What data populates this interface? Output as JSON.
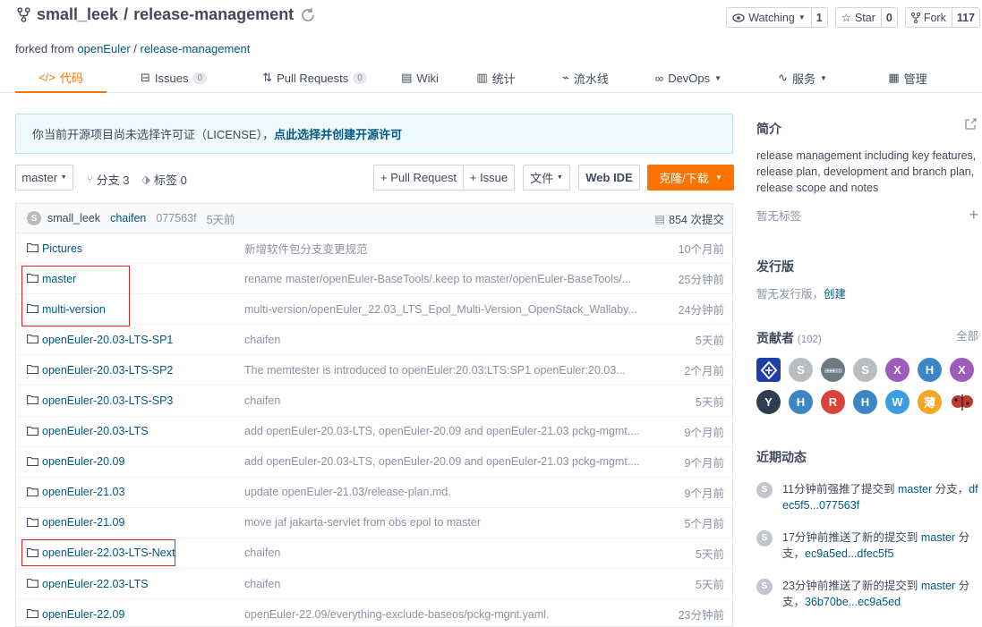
{
  "repo": {
    "owner": "small_leek",
    "sep": "/",
    "name": "release-management",
    "forked_prefix": "forked from",
    "forked_owner": "openEuler",
    "forked_repo": "release-management"
  },
  "actions": {
    "watch_label": "Watching",
    "watch_count": "1",
    "star_label": "Star",
    "star_count": "0",
    "fork_label": "Fork",
    "fork_count": "117"
  },
  "tabs": [
    {
      "label": "代码",
      "active": true
    },
    {
      "label": "Issues",
      "badge": "0"
    },
    {
      "label": "Pull Requests",
      "badge": "0"
    },
    {
      "label": "Wiki"
    },
    {
      "label": "统计"
    },
    {
      "label": "流水线"
    },
    {
      "label": "DevOps"
    },
    {
      "label": "服务"
    },
    {
      "label": "管理"
    }
  ],
  "notice": {
    "text": "你当前开源项目尚未选择许可证（LICENSE），",
    "link": "点此选择并创建开源许可"
  },
  "toolbar": {
    "branch": "master",
    "branches": "分支 3",
    "tags": "标签 0",
    "pull_request": "+ Pull Request",
    "issue": "+ Issue",
    "file": "文件",
    "web_ide": "Web IDE",
    "clone": "克隆/下载"
  },
  "commit": {
    "avatar": "S",
    "author": "small_leek",
    "committer": "chaifen",
    "sha": "077563f",
    "time": "5天前",
    "count": "854 次提交"
  },
  "files": [
    {
      "name": "Pictures",
      "msg": "新增软件包分支变更规范",
      "time": "10个月前"
    },
    {
      "name": "master",
      "msg": "rename master/openEuler-BaseTools/.keep to master/openEuler-BaseTools/...",
      "time": "25分钟前"
    },
    {
      "name": "multi-version",
      "msg": "multi-version/openEuler_22.03_LTS_Epol_Multi-Version_OpenStack_Wallaby...",
      "time": "24分钟前"
    },
    {
      "name": "openEuler-20.03-LTS-SP1",
      "msg": "chaifen",
      "time": "5天前"
    },
    {
      "name": "openEuler-20.03-LTS-SP2",
      "msg": "The memtester is introduced to openEuler:20.03:LTS:SP1 openEuler:20.03...",
      "time": "2个月前"
    },
    {
      "name": "openEuler-20.03-LTS-SP3",
      "msg": "chaifen",
      "time": "5天前"
    },
    {
      "name": "openEuler-20.03-LTS",
      "msg": "add openEuler-20.03-LTS, openEuler-20.09 and openEuler-21.03 pckg-mgmt....",
      "time": "9个月前"
    },
    {
      "name": "openEuler-20.09",
      "msg": "add openEuler-20.03-LTS, openEuler-20.09 and openEuler-21.03 pckg-mgmt....",
      "time": "9个月前"
    },
    {
      "name": "openEuler-21.03",
      "msg": "update openEuler-21.03/release-plan.md.",
      "time": "9个月前"
    },
    {
      "name": "openEuler-21.09",
      "msg": "move jaf jakarta-servlet from obs epol to master",
      "time": "5个月前"
    },
    {
      "name": "openEuler-22.03-LTS-Next",
      "msg": "chaifen",
      "time": "5天前"
    },
    {
      "name": "openEuler-22.03-LTS",
      "msg": "chaifen",
      "time": "5天前"
    },
    {
      "name": "openEuler-22.09",
      "msg": "openEuler-22.09/everything-exclude-baseos/pckg-mgnt.yaml.",
      "time": "23分钟前"
    }
  ],
  "sidebar": {
    "intro_title": "简介",
    "intro_text": "release management including key features, release plan, development and branch plan, release scope and notes",
    "no_tags": "暂无标签",
    "release_title": "发行版",
    "release_none": "暂无发行版，",
    "release_create": "创建",
    "contrib_title": "贡献者",
    "contrib_count": "(102)",
    "contrib_all": "全部",
    "avatars": [
      {
        "t": "",
        "color": "#1f3fa8"
      },
      {
        "t": "S",
        "color": "#b9bcc1"
      },
      {
        "t": "",
        "color": "#6d7a80"
      },
      {
        "t": "S",
        "color": "#b9bcc1"
      },
      {
        "t": "X",
        "color": "#9c5bbd"
      },
      {
        "t": "H",
        "color": "#3d86c6"
      },
      {
        "t": "X",
        "color": "#9c5bbd"
      },
      {
        "t": "Y",
        "color": "#2c3e50"
      },
      {
        "t": "H",
        "color": "#3d86c6"
      },
      {
        "t": "R",
        "color": "#d9433b"
      },
      {
        "t": "H",
        "color": "#3d86c6"
      },
      {
        "t": "W",
        "color": "#3a9ee0"
      },
      {
        "t": "薄",
        "color": "#f5a623"
      },
      {
        "t": "",
        "color": "#ffffff"
      }
    ],
    "activity_title": "近期动态",
    "activities": [
      {
        "pre": "11分钟前强推了提交到 ",
        "link": "master",
        "mid": " 分支，",
        "tail": "df",
        "ref": "ec5f5...077563f"
      },
      {
        "pre": "17分钟前推送了新的提交到 ",
        "link": "master",
        "mid": " 分",
        "tail": "",
        "pre2": "支，",
        "ref": "ec9a5ed...dfec5f5"
      },
      {
        "pre": "23分钟前推送了新的提交到 ",
        "link": "master",
        "mid": " 分",
        "tail": "",
        "pre2": "支，",
        "ref": "36b70be...ec9a5ed"
      }
    ]
  }
}
